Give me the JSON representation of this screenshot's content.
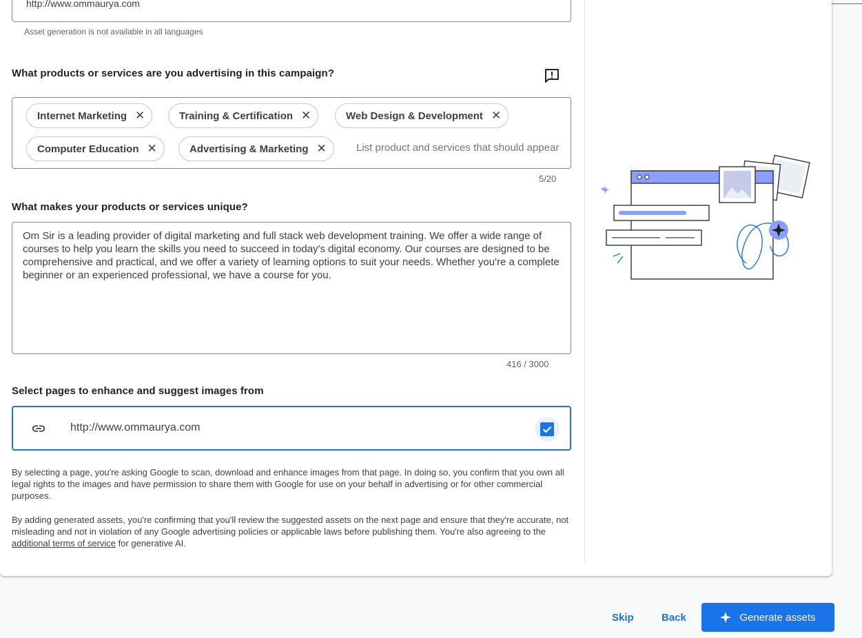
{
  "top_url": {
    "value": "http://www.ommaurya.com"
  },
  "helper_text": "Asset generation is not available in all languages",
  "products": {
    "title": "What products or services are you advertising in this campaign?",
    "chips": [
      {
        "label": "Internet Marketing"
      },
      {
        "label": "Training & Certification"
      },
      {
        "label": "Web Design & Development"
      },
      {
        "label": "Computer Education"
      },
      {
        "label": "Advertising & Marketing"
      }
    ],
    "placeholder": "List product and services that should appear",
    "counter": "5/20"
  },
  "unique": {
    "title": "What makes your products or services unique?",
    "value": "Om Sir is a leading provider of digital marketing and full stack web development training. We offer a wide range of courses to help you learn the skills you need to succeed in today's digital economy. Our courses are designed to be comprehensive and practical, and we offer a variety of learning options to suit your needs. Whether you're a complete beginner or an experienced professional, we have a course for you.",
    "counter": "416 / 3000"
  },
  "pages": {
    "title": "Select pages to enhance and suggest images from",
    "url": "http://www.ommaurya.com",
    "checked": true
  },
  "disclaimer": {
    "p1": "By selecting a page, you're asking Google to scan, download and enhance images from that page. In doing so, you confirm that you own all legal rights to the images and have permission to share them with Google for use on your behalf in advertising or for other commercial purposes.",
    "p2_before": "By adding generated assets, you're confirming that you'll review the suggested assets on the next page and ensure that they're accurate, not misleading and not in violation of any Google advertising policies or applicable laws before publishing them. You're also agreeing to the ",
    "p2_link": "additional terms of service",
    "p2_after": " for generative AI."
  },
  "footer": {
    "skip": "Skip",
    "back": "Back",
    "generate": "Generate assets"
  },
  "colors": {
    "accent": "#1a73e8",
    "illustration_accent": "#8c9eff"
  }
}
